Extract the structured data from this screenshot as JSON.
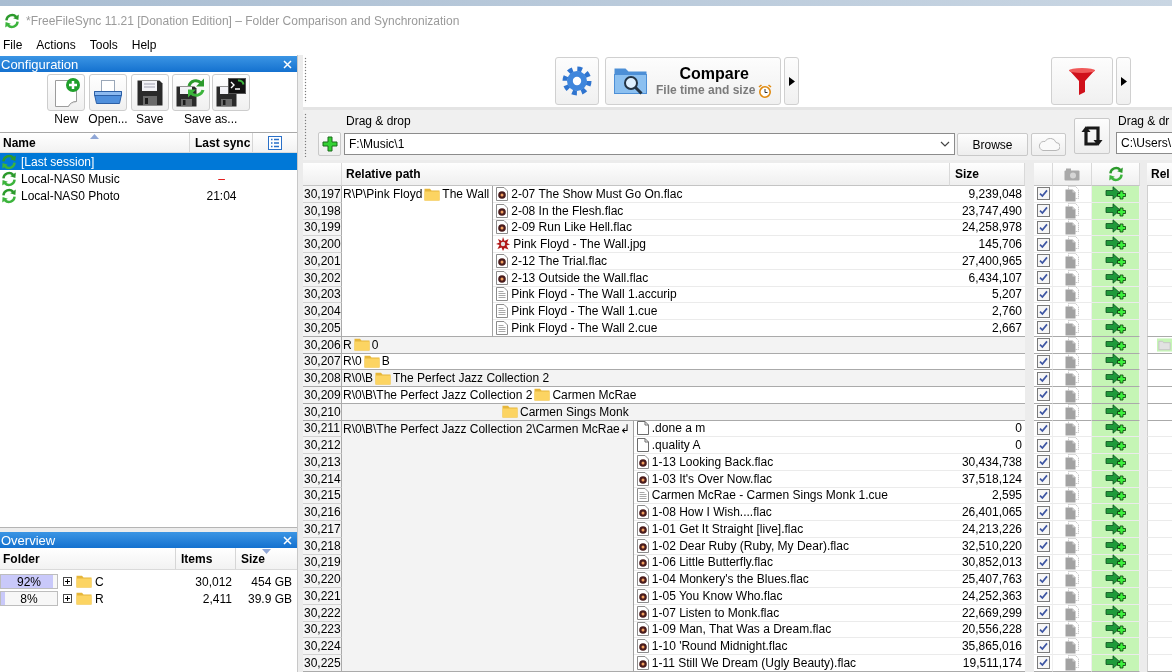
{
  "window": {
    "title": "*FreeFileSync 11.21 [Donation Edition] – Folder Comparison and Synchronization"
  },
  "menu": [
    "File",
    "Actions",
    "Tools",
    "Help"
  ],
  "configuration": {
    "title": "Configuration",
    "buttons": [
      {
        "kind": "new",
        "label": "New"
      },
      {
        "kind": "open",
        "label": "Open..."
      },
      {
        "kind": "save",
        "label": "Save"
      },
      {
        "kind": "save_as",
        "label": "Save as..."
      }
    ],
    "columns": [
      {
        "label": "Name",
        "sorted": true,
        "descending": false
      },
      {
        "label": "Last sync",
        "sorted": false
      }
    ],
    "items": [
      {
        "name": "[Last session]",
        "selected": true
      },
      {
        "name": "Local-NAS0 Music",
        "last_sync": "–",
        "overdue": true,
        "selected": false
      },
      {
        "name": "Local-NAS0 Photo",
        "last_sync": "21:04",
        "overdue": false,
        "selected": false
      }
    ]
  },
  "overview": {
    "title": "Overview",
    "columns": [
      {
        "label": "Folder",
        "sorted": false
      },
      {
        "label": "Items",
        "sorted": false
      },
      {
        "label": "Size",
        "sorted": true,
        "descending": true
      }
    ],
    "rows": [
      {
        "percent": "92%",
        "level": 0.92,
        "expanded": false,
        "name": "C",
        "items": "30,012",
        "size": "454 GB"
      },
      {
        "percent": "8%",
        "level": 0.08,
        "expanded": false,
        "name": "R",
        "items": "2,411",
        "size": "39.9 GB"
      }
    ]
  },
  "toolbar": {
    "compare": {
      "label": "Compare",
      "variant": "File time and size"
    }
  },
  "folder_pair": {
    "left": {
      "label": "Drag & drop",
      "path": "F:\\Music\\1",
      "browse": "Browse"
    },
    "right": {
      "label": "Drag & dr",
      "path": "C:\\Users\\"
    }
  },
  "grid": {
    "left_columns": [
      {
        "label": "Relative path"
      },
      {
        "label": "Size"
      }
    ],
    "right_columns": [
      {
        "label": "Rel"
      }
    ],
    "items": [
      {
        "kind": "group",
        "path": "R\\P\\Pink Floyd",
        "folder": "The Wall",
        "files": [
          {
            "number": "30,197",
            "kind": "audio",
            "name": "2-07 The Show Must Go On.flac",
            "size": "9,239,048",
            "checked": true,
            "left_only": true,
            "copy_to_right": true
          },
          {
            "number": "30,198",
            "kind": "audio",
            "name": "2-08 In the Flesh.flac",
            "size": "23,747,490",
            "checked": true,
            "left_only": true,
            "copy_to_right": true
          },
          {
            "number": "30,199",
            "kind": "audio",
            "name": "2-09 Run Like Hell.flac",
            "size": "24,258,978",
            "checked": true,
            "left_only": true,
            "copy_to_right": true
          },
          {
            "number": "30,200",
            "kind": "image",
            "name": "Pink Floyd - The Wall.jpg",
            "size": "145,706",
            "checked": true,
            "left_only": true,
            "copy_to_right": true
          },
          {
            "number": "30,201",
            "kind": "audio",
            "name": "2-12 The Trial.flac",
            "size": "27,400,965",
            "checked": true,
            "left_only": true,
            "copy_to_right": true
          },
          {
            "number": "30,202",
            "kind": "audio",
            "name": "2-13 Outside the Wall.flac",
            "size": "6,434,107",
            "checked": true,
            "left_only": true,
            "copy_to_right": true
          },
          {
            "number": "30,203",
            "kind": "document",
            "name": "Pink Floyd - The Wall 1.accurip",
            "size": "5,207",
            "checked": true,
            "left_only": true,
            "copy_to_right": true
          },
          {
            "number": "30,204",
            "kind": "document",
            "name": "Pink Floyd - The Wall 1.cue",
            "size": "2,760",
            "checked": true,
            "left_only": true,
            "copy_to_right": true
          },
          {
            "number": "30,205",
            "kind": "document",
            "name": "Pink Floyd - The Wall 2.cue",
            "size": "2,667",
            "checked": true,
            "left_only": true,
            "copy_to_right": true
          }
        ]
      },
      {
        "kind": "folder",
        "number": "30,206",
        "path": "R",
        "name": "0",
        "checked": true,
        "left_only": true,
        "copy_to_right": true,
        "right_placeholder": true
      },
      {
        "kind": "folder",
        "number": "30,207",
        "path": "R\\0",
        "name": "B",
        "checked": true,
        "left_only": true,
        "copy_to_right": true,
        "right_placeholder": false
      },
      {
        "kind": "folder",
        "number": "30,208",
        "path": "R\\0\\B",
        "name": "The Perfect Jazz Collection 2",
        "checked": true,
        "left_only": true,
        "copy_to_right": true,
        "right_placeholder": false
      },
      {
        "kind": "folder",
        "number": "30,209",
        "path": "R\\0\\B\\The Perfect Jazz Collection 2",
        "name": "Carmen McRae",
        "checked": true,
        "left_only": true,
        "copy_to_right": true,
        "right_placeholder": false
      },
      {
        "kind": "group",
        "header": {
          "number": "30,210",
          "name": "Carmen Sings Monk",
          "checked": true,
          "left_only": true,
          "copy_to_right": true,
          "right_placeholder": false
        },
        "path": "R\\0\\B\\The Perfect Jazz Collection 2\\Carmen McRae↲",
        "files": [
          {
            "number": "30,211",
            "kind": "blank",
            "name": ".done a m",
            "size": "0",
            "checked": true,
            "left_only": true,
            "copy_to_right": true
          },
          {
            "number": "30,212",
            "kind": "blank",
            "name": ".quality A",
            "size": "0",
            "checked": true,
            "left_only": true,
            "copy_to_right": true
          },
          {
            "number": "30,213",
            "kind": "audio",
            "name": "1-13 Looking Back.flac",
            "size": "30,434,738",
            "checked": true,
            "left_only": true,
            "copy_to_right": true
          },
          {
            "number": "30,214",
            "kind": "audio",
            "name": "1-03 It's Over Now.flac",
            "size": "37,518,124",
            "checked": true,
            "left_only": true,
            "copy_to_right": true
          },
          {
            "number": "30,215",
            "kind": "document",
            "name": "Carmen McRae - Carmen Sings Monk 1.cue",
            "size": "2,595",
            "checked": true,
            "left_only": true,
            "copy_to_right": true
          },
          {
            "number": "30,216",
            "kind": "audio",
            "name": "1-08 How I Wish....flac",
            "size": "26,401,065",
            "checked": true,
            "left_only": true,
            "copy_to_right": true
          },
          {
            "number": "30,217",
            "kind": "audio",
            "name": "1-01 Get It Straight [live].flac",
            "size": "24,213,226",
            "checked": true,
            "left_only": true,
            "copy_to_right": true
          },
          {
            "number": "30,218",
            "kind": "audio",
            "name": "1-02 Dear Ruby (Ruby, My Dear).flac",
            "size": "32,510,220",
            "checked": true,
            "left_only": true,
            "copy_to_right": true
          },
          {
            "number": "30,219",
            "kind": "audio",
            "name": "1-06 Little Butterfly.flac",
            "size": "30,852,013",
            "checked": true,
            "left_only": true,
            "copy_to_right": true
          },
          {
            "number": "30,220",
            "kind": "audio",
            "name": "1-04 Monkery's the Blues.flac",
            "size": "25,407,763",
            "checked": true,
            "left_only": true,
            "copy_to_right": true
          },
          {
            "number": "30,221",
            "kind": "audio",
            "name": "1-05 You Know Who.flac",
            "size": "24,252,363",
            "checked": true,
            "left_only": true,
            "copy_to_right": true
          },
          {
            "number": "30,222",
            "kind": "audio",
            "name": "1-07 Listen to Monk.flac",
            "size": "22,669,299",
            "checked": true,
            "left_only": true,
            "copy_to_right": true
          },
          {
            "number": "30,223",
            "kind": "audio",
            "name": "1-09 Man, That Was a Dream.flac",
            "size": "20,556,228",
            "checked": true,
            "left_only": true,
            "copy_to_right": true
          },
          {
            "number": "30,224",
            "kind": "audio",
            "name": "1-10 'Round Midnight.flac",
            "size": "35,865,016",
            "checked": true,
            "left_only": true,
            "copy_to_right": true
          },
          {
            "number": "30,225",
            "kind": "audio",
            "name": "1-11 Still We Dream (Ugly Beauty).flac",
            "size": "19,511,174",
            "checked": true,
            "left_only": true,
            "copy_to_right": true
          }
        ]
      }
    ]
  }
}
